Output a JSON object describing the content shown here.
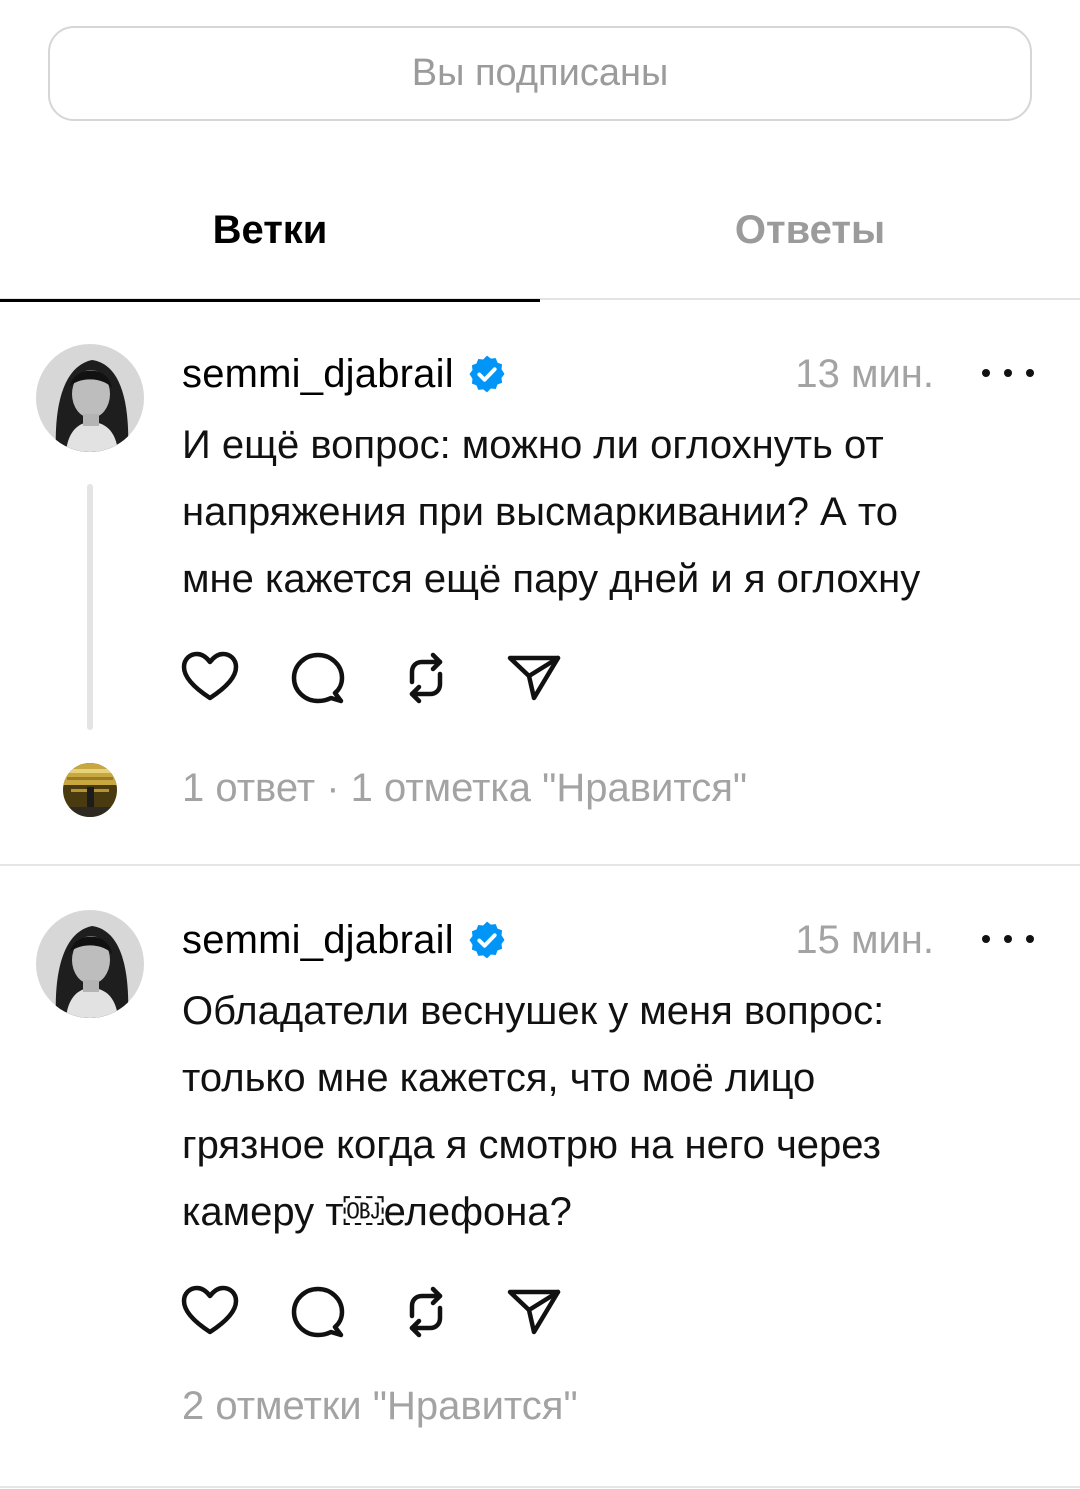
{
  "follow_button": {
    "label": "Вы подписаны"
  },
  "tabs": [
    {
      "label": "Ветки",
      "active": true
    },
    {
      "label": "Ответы",
      "active": false
    }
  ],
  "posts": [
    {
      "username": "semmi_djabrail",
      "verified": true,
      "time": "13 мин.",
      "lines": [
        "И ещё вопрос: можно ли оглохнуть от",
        "напряжения при высмаркивании? А то",
        "мне кажется ещё пару дней и я оглохну"
      ],
      "stats": "1 ответ · 1 отметка \"Нравится\""
    },
    {
      "username": "semmi_djabrail",
      "verified": true,
      "time": "15 мин.",
      "lines": [
        "Обладатели веснушек у меня вопрос:",
        "только мне кажется, что моё лицо",
        "грязное когда я смотрю на него через",
        "камеру т￼елефона?"
      ],
      "stats": "2 отметки \"Нравится\""
    }
  ],
  "icons": {
    "avatar": "profile-photo-grayscale",
    "verified": "verified-badge-icon",
    "more": "more-options-icon",
    "like": "heart-icon",
    "comment": "comment-bubble-icon",
    "repost": "repost-icon",
    "share": "send-icon"
  },
  "colors": {
    "accent_verified": "#0095f6",
    "muted_text": "#a3a3a3",
    "divider": "#e6e6e6"
  }
}
